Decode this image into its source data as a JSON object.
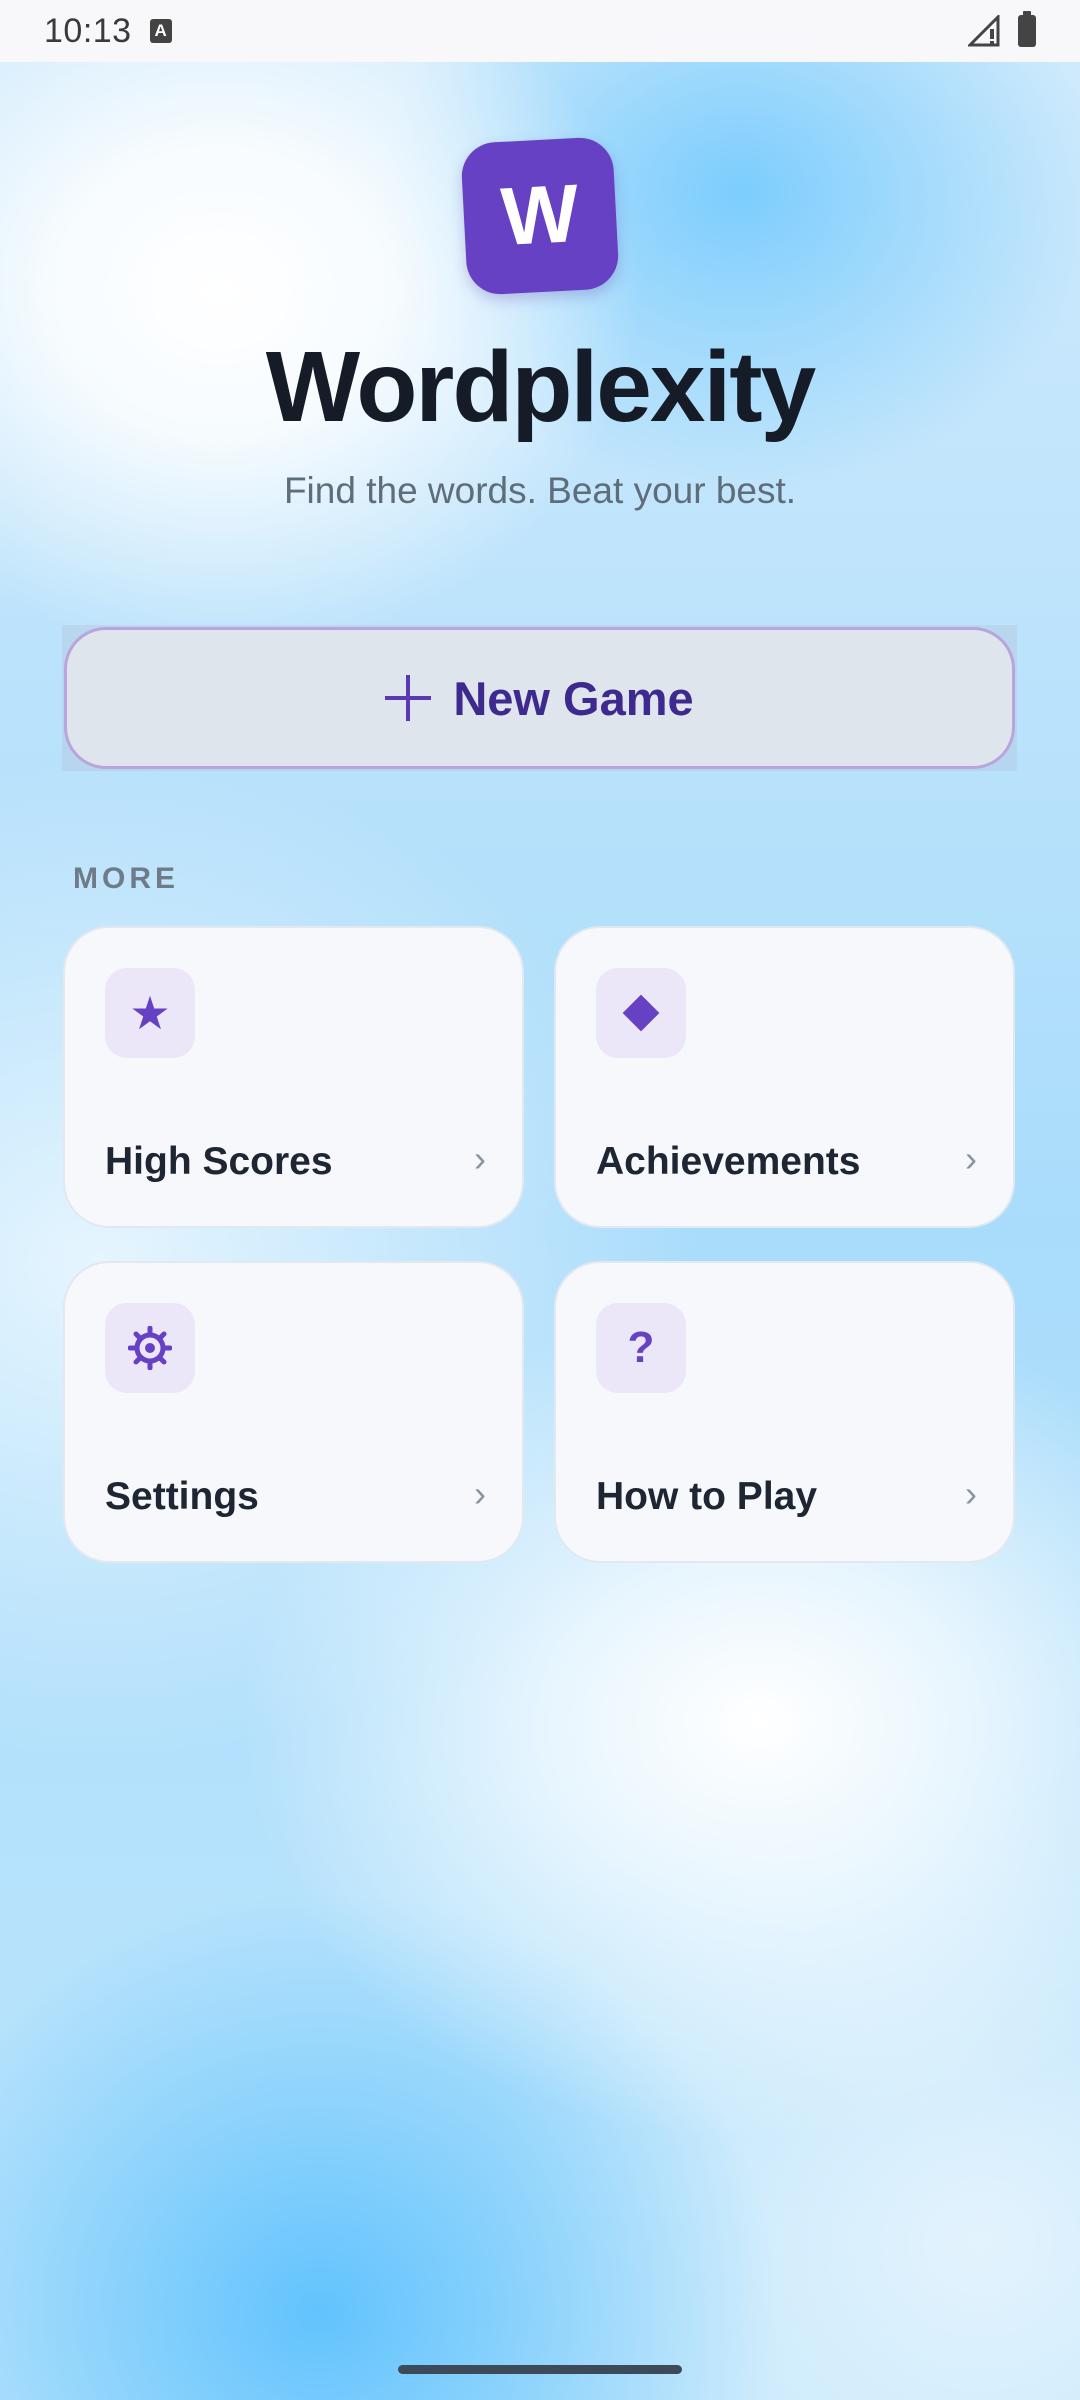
{
  "status_bar": {
    "time": "10:13",
    "notification_icon": "A"
  },
  "app": {
    "logo_letter": "W",
    "title": "Wordplexity",
    "tagline": "Find the words. Beat your best.",
    "brand_color": "#6741c4"
  },
  "primary_action": {
    "label": "New Game",
    "icon": "plus-icon"
  },
  "more_section": {
    "heading": "MORE",
    "items": [
      {
        "label": "High Scores",
        "icon": "star-icon"
      },
      {
        "label": "Achievements",
        "icon": "diamond-icon"
      },
      {
        "label": "Settings",
        "icon": "gear-icon"
      },
      {
        "label": "How to Play",
        "icon": "question-icon",
        "glyph": "?"
      }
    ],
    "chevron": "›"
  }
}
